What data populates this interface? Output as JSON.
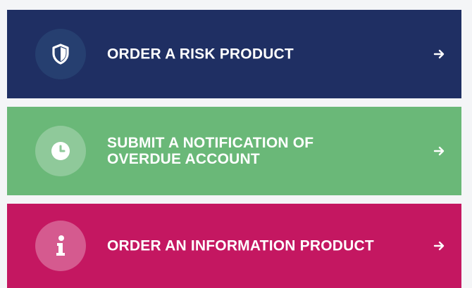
{
  "actions": [
    {
      "label": "ORDER A RISK PRODUCT",
      "icon": "shield-icon",
      "background": "#1f2f63",
      "icon_circle": "#263f70",
      "icon_color": "#ffffff"
    },
    {
      "label": "SUBMIT A NOTIFICATION OF\nOVERDUE ACCOUNT",
      "icon": "clock-icon",
      "background": "#6ab878",
      "icon_circle": "#8fc99a",
      "icon_color": "#ffffff"
    },
    {
      "label": "ORDER AN INFORMATION PRODUCT",
      "icon": "info-icon",
      "background": "#c41761",
      "icon_circle": "#d55a8f",
      "icon_color": "#ffffff"
    }
  ],
  "arrow_icon": "arrow-right-icon"
}
